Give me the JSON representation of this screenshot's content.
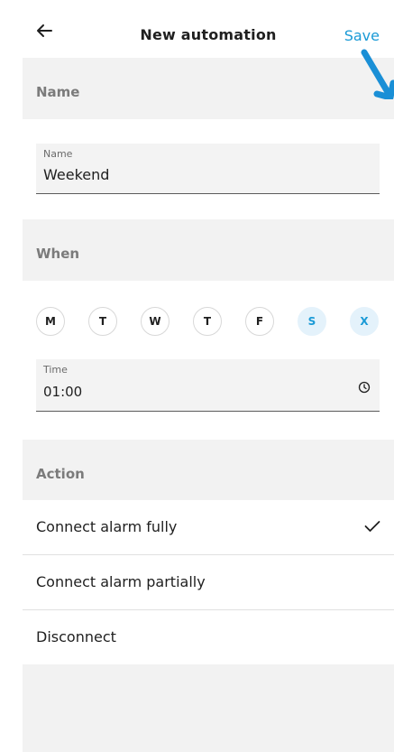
{
  "header": {
    "title": "New automation",
    "save_label": "Save",
    "back_icon": "arrow-left-icon"
  },
  "sections": {
    "name": "Name",
    "when": "When",
    "action": "Action"
  },
  "name_field": {
    "label": "Name",
    "value": "Weekend"
  },
  "days": [
    {
      "label": "M",
      "selected": false
    },
    {
      "label": "T",
      "selected": false
    },
    {
      "label": "W",
      "selected": false
    },
    {
      "label": "T",
      "selected": false
    },
    {
      "label": "F",
      "selected": false
    },
    {
      "label": "S",
      "selected": true
    },
    {
      "label": "X",
      "selected": true
    }
  ],
  "time_field": {
    "label": "Time",
    "value": "01:00",
    "icon": "clock-icon"
  },
  "actions": [
    {
      "label": "Connect alarm fully",
      "selected": true
    },
    {
      "label": "Connect alarm partially",
      "selected": false
    },
    {
      "label": "Disconnect",
      "selected": false
    }
  ],
  "colors": {
    "accent": "#1a9ad6",
    "selected_day_bg": "#e4f2fb",
    "section_bg": "#f2f2f2",
    "pointer": "#1a8fd6"
  }
}
